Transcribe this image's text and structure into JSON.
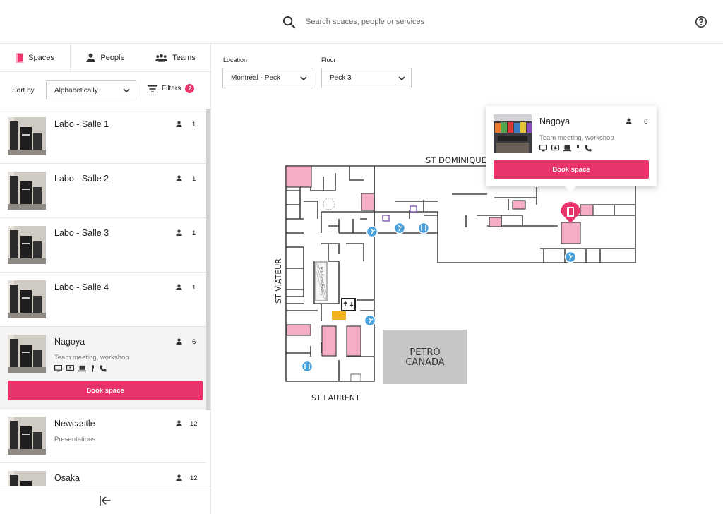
{
  "search": {
    "placeholder": "Search spaces, people or services"
  },
  "tabs": [
    {
      "label": "Spaces",
      "icon": "door-icon",
      "active": true
    },
    {
      "label": "People",
      "icon": "person-icon"
    },
    {
      "label": "Teams",
      "icon": "group-icon"
    }
  ],
  "sort": {
    "label": "Sort by",
    "value": "Alphabetically"
  },
  "filters": {
    "label": "Filters",
    "count": "2"
  },
  "filter_bar": {
    "location_label": "Location",
    "location_value": "Montréal - Peck",
    "floor_label": "Floor",
    "floor_value": "Peck 3"
  },
  "spaces": [
    {
      "name": "Labo - Salle 1",
      "capacity": "1",
      "description": ""
    },
    {
      "name": "Labo - Salle 2",
      "capacity": "1",
      "description": ""
    },
    {
      "name": "Labo - Salle 3",
      "capacity": "1",
      "description": ""
    },
    {
      "name": "Labo - Salle 4",
      "capacity": "1",
      "description": ""
    },
    {
      "name": "Nagoya",
      "capacity": "6",
      "description": "Team meeting, workshop",
      "book_label": "Book space",
      "selected": true,
      "amenities": [
        "monitor-icon",
        "presentation-screen-icon",
        "laptop-icon",
        "microphone-icon",
        "phone-icon"
      ]
    },
    {
      "name": "Newcastle",
      "capacity": "12",
      "description": "Presentations"
    },
    {
      "name": "Osaka",
      "capacity": "12",
      "description": ""
    }
  ],
  "popup": {
    "name": "Nagoya",
    "capacity": "6",
    "description": "Team meeting, workshop",
    "book_label": "Book space",
    "amenities": [
      "monitor-icon",
      "presentation-screen-icon",
      "laptop-icon",
      "microphone-icon",
      "phone-icon"
    ]
  },
  "map": {
    "street_top": "ST DOMINIQUE",
    "street_left": "ST VIATEUR",
    "street_bottom": "ST LAURENT",
    "building": "PETRO\nCANADA",
    "building_line1": "PETRO",
    "building_line2": "CANADA",
    "construction": "CONSTRUCTION"
  },
  "colors": {
    "accent": "#e8336b",
    "room_pink": "#f4adc5",
    "highlight_yellow": "#f2b01e",
    "service_blue": "#4aa3dc"
  }
}
